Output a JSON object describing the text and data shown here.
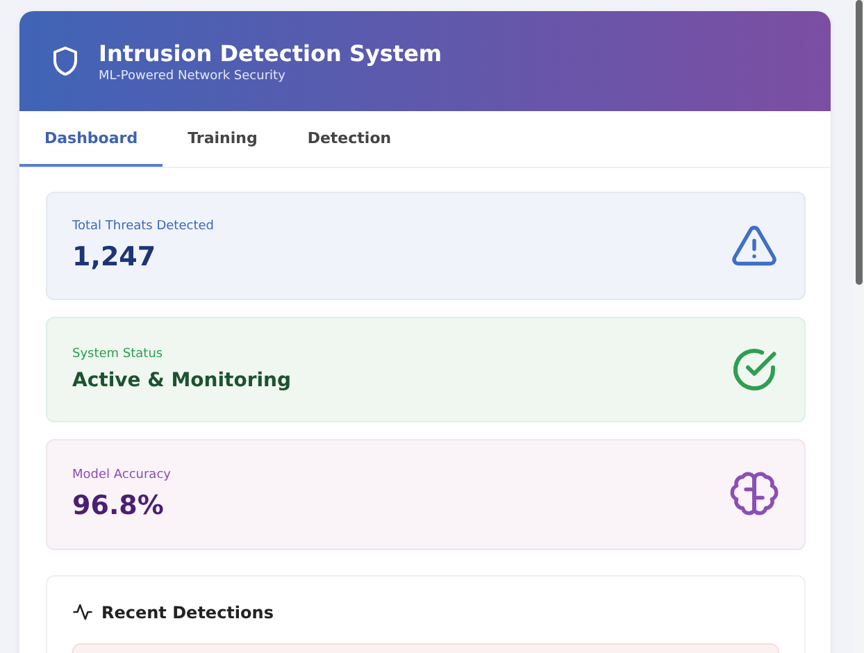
{
  "header": {
    "title": "Intrusion Detection System",
    "subtitle": "ML-Powered Network Security"
  },
  "tabs": [
    {
      "label": "Dashboard",
      "selected": true
    },
    {
      "label": "Training",
      "selected": false
    },
    {
      "label": "Detection",
      "selected": false
    }
  ],
  "stats": [
    {
      "kind": "threats",
      "label": "Total Threats Detected",
      "value": "1,247"
    },
    {
      "kind": "status",
      "label": "System Status",
      "value": "Active & Monitoring"
    },
    {
      "kind": "accuracy",
      "label": "Model Accuracy",
      "value": "96.8%"
    }
  ],
  "recent": {
    "title": "Recent Detections"
  }
}
